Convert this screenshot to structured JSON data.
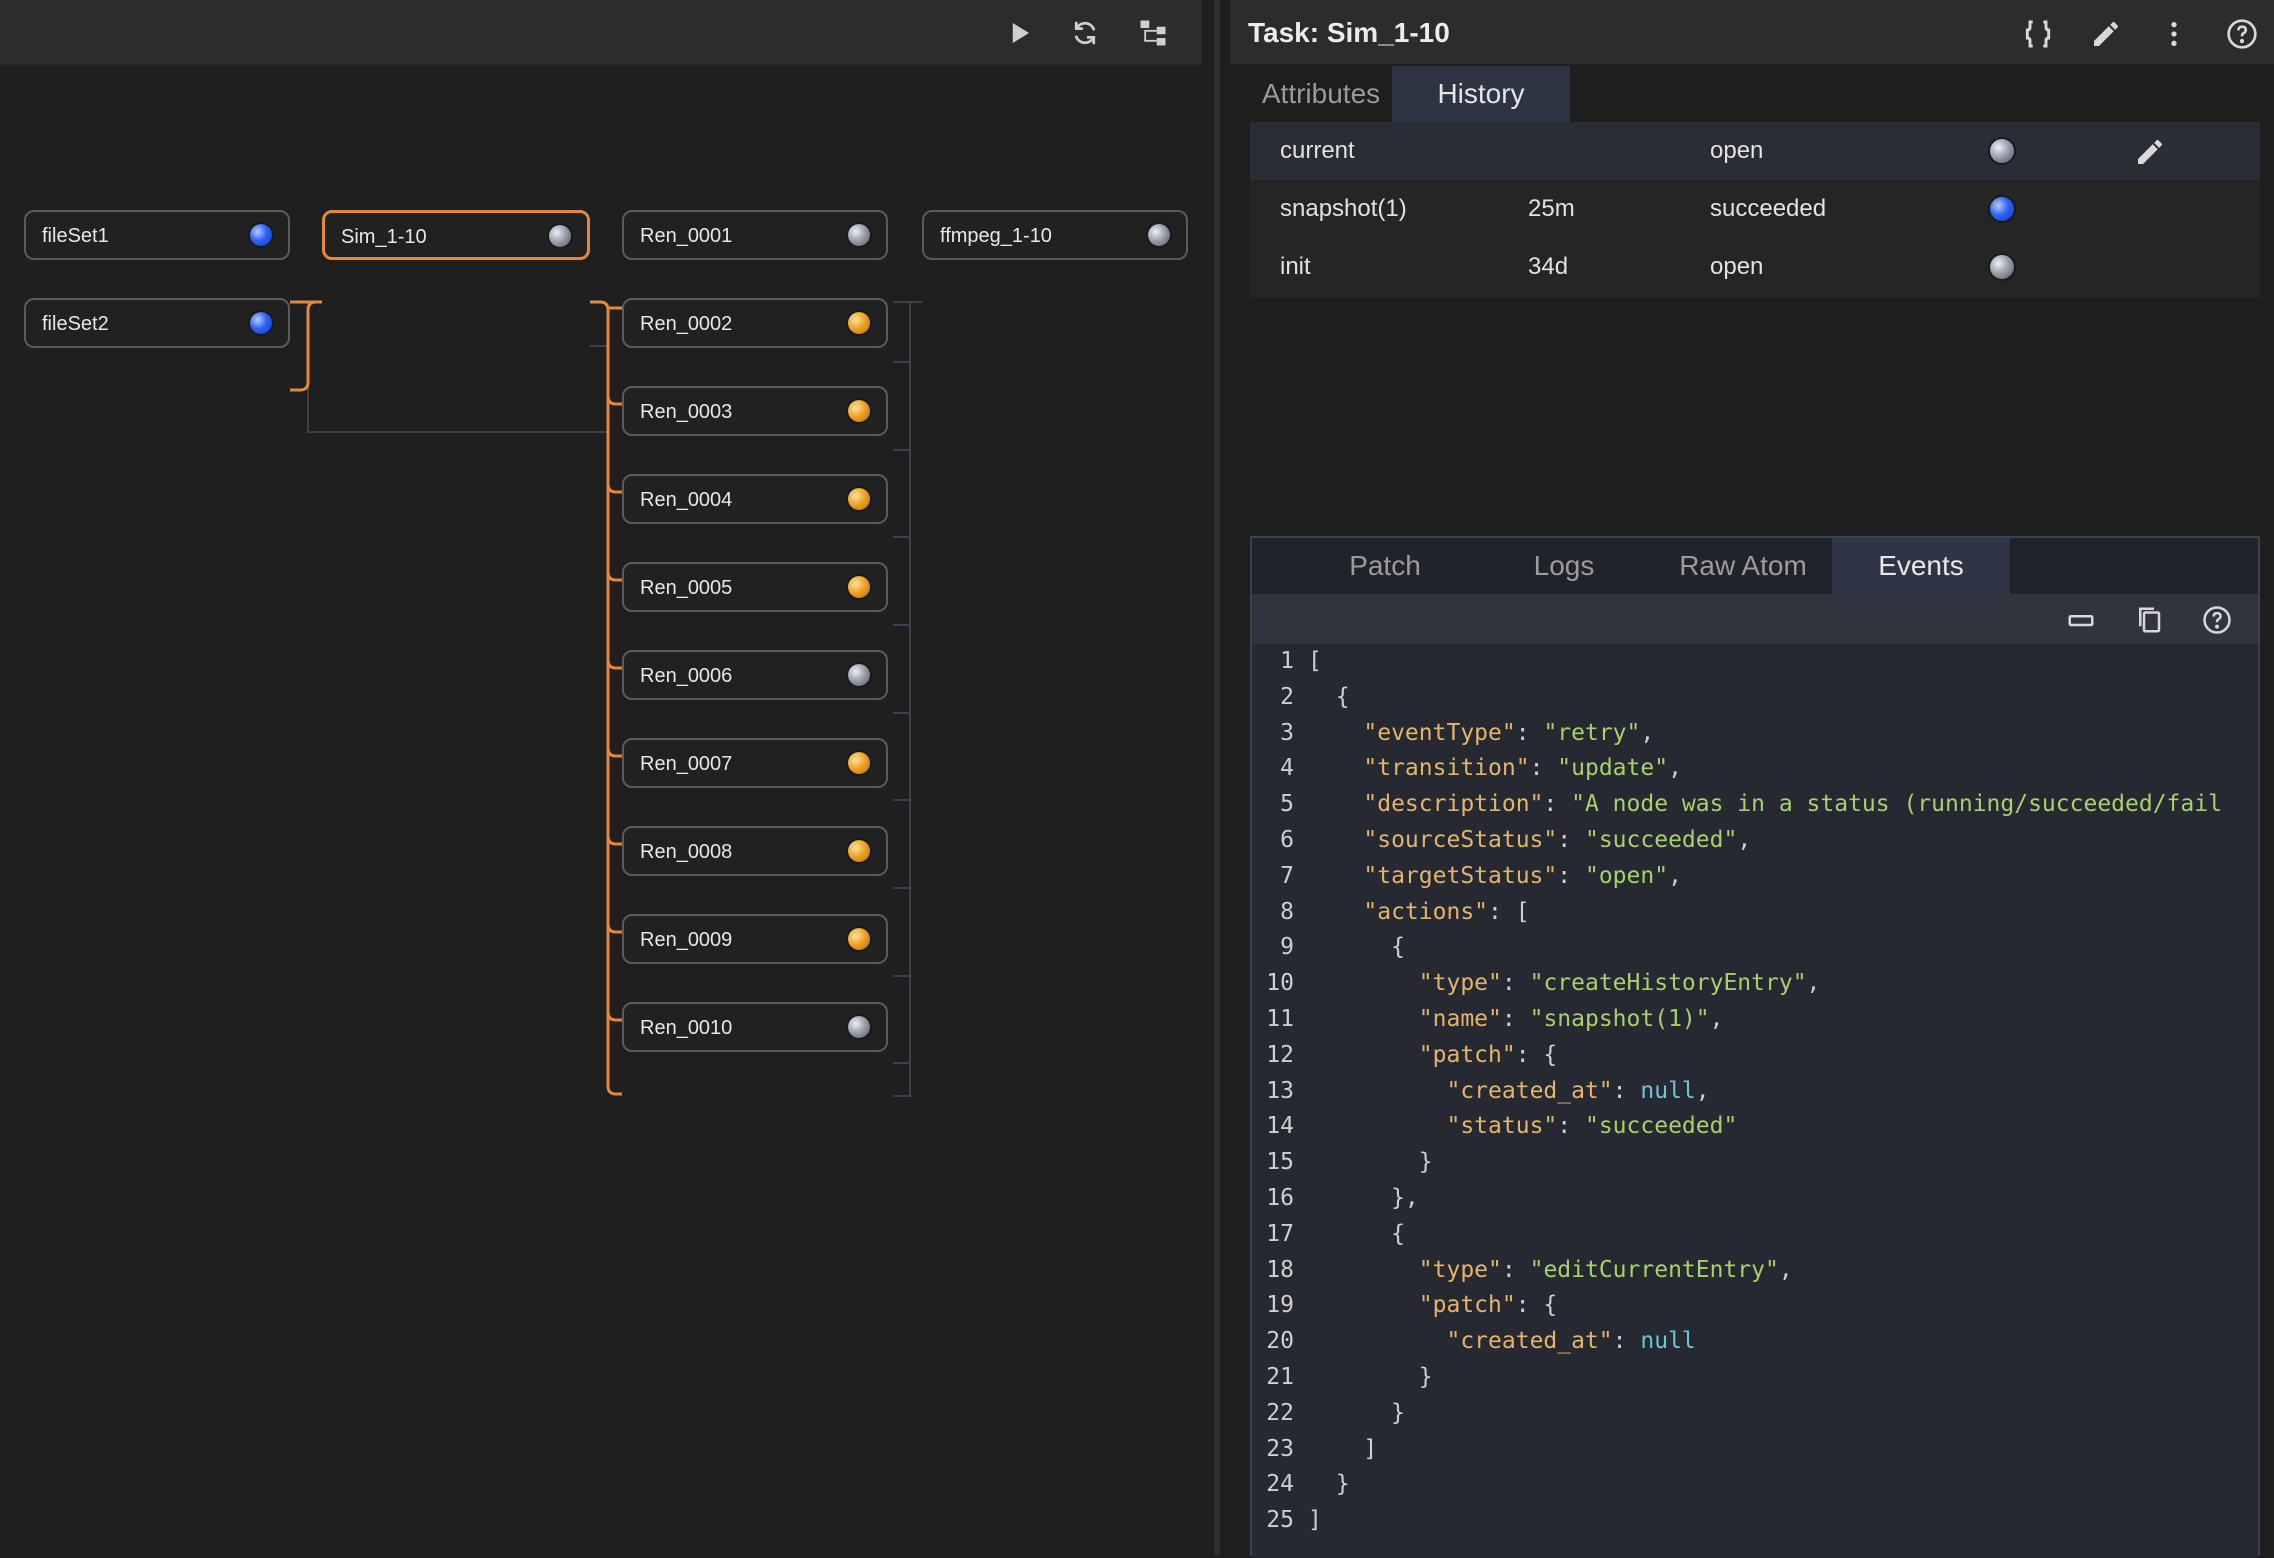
{
  "graph": {
    "toolbar": [
      "play-icon",
      "refresh-icon",
      "hierarchy-icon"
    ],
    "nodes": [
      {
        "id": "fileSet1",
        "label": "fileSet1",
        "status": "blue"
      },
      {
        "id": "fileSet2",
        "label": "fileSet2",
        "status": "blue"
      },
      {
        "id": "sim",
        "label": "Sim_1-10",
        "status": "gray",
        "selected": true
      },
      {
        "id": "r1",
        "label": "Ren_0001",
        "status": "gray"
      },
      {
        "id": "r2",
        "label": "Ren_0002",
        "status": "orange"
      },
      {
        "id": "r3",
        "label": "Ren_0003",
        "status": "orange"
      },
      {
        "id": "r4",
        "label": "Ren_0004",
        "status": "orange"
      },
      {
        "id": "r5",
        "label": "Ren_0005",
        "status": "orange"
      },
      {
        "id": "r6",
        "label": "Ren_0006",
        "status": "gray"
      },
      {
        "id": "r7",
        "label": "Ren_0007",
        "status": "orange"
      },
      {
        "id": "r8",
        "label": "Ren_0008",
        "status": "orange"
      },
      {
        "id": "r9",
        "label": "Ren_0009",
        "status": "orange"
      },
      {
        "id": "r10",
        "label": "Ren_0010",
        "status": "gray"
      },
      {
        "id": "ffmpeg",
        "label": "ffmpeg_1-10",
        "status": "gray"
      }
    ],
    "colors": {
      "selected_edge": "#e5883a",
      "edge": "#3a4250"
    }
  },
  "task": {
    "title": "Task: Sim_1-10",
    "header_icons": [
      "braces-icon",
      "pencil-icon",
      "more-vert-icon",
      "help-icon"
    ],
    "tabs": [
      {
        "label": "Attributes",
        "active": false
      },
      {
        "label": "History",
        "active": true
      }
    ],
    "history": [
      {
        "name": "current",
        "age": "",
        "status": "open",
        "dot": "gray",
        "editable": true
      },
      {
        "name": "snapshot(1)",
        "age": "25m",
        "status": "succeeded",
        "dot": "blue",
        "editable": false
      },
      {
        "name": "init",
        "age": "34d",
        "status": "open",
        "dot": "gray",
        "editable": false
      }
    ],
    "detail_tabs": [
      {
        "label": "Patch",
        "active": false
      },
      {
        "label": "Logs",
        "active": false
      },
      {
        "label": "Raw Atom",
        "active": false
      },
      {
        "label": "Events",
        "active": true
      }
    ],
    "editor_icons": [
      "collapse-icon",
      "copy-icon",
      "help-icon"
    ],
    "code_lines": [
      "[",
      "  {",
      "    \"eventType\": \"retry\",",
      "    \"transition\": \"update\",",
      "    \"description\": \"A node was in a status (running/succeeded/fail",
      "    \"sourceStatus\": \"succeeded\",",
      "    \"targetStatus\": \"open\",",
      "    \"actions\": [",
      "      {",
      "        \"type\": \"createHistoryEntry\",",
      "        \"name\": \"snapshot(1)\",",
      "        \"patch\": {",
      "          \"created_at\": null,",
      "          \"status\": \"succeeded\"",
      "        }",
      "      },",
      "      {",
      "        \"type\": \"editCurrentEntry\",",
      "        \"patch\": {",
      "          \"created_at\": null",
      "        }",
      "      }",
      "    ]",
      "  }",
      "]"
    ]
  }
}
